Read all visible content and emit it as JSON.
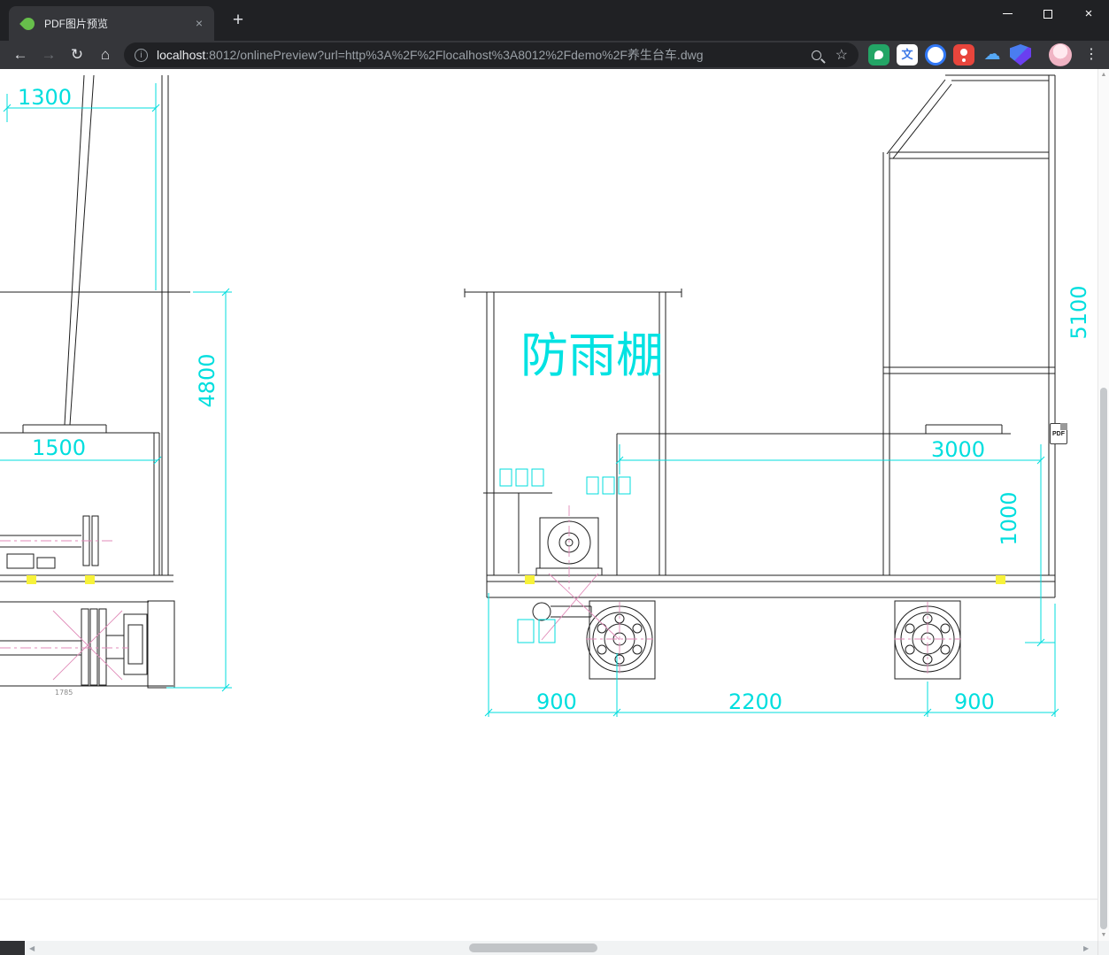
{
  "tab_strip": {
    "active_tab_title": "PDF图片预览"
  },
  "glyphs": {
    "tab_close": "×",
    "new_tab": "+",
    "window_close": "×",
    "back": "←",
    "forward": "→",
    "reload": "↻",
    "home": "⌂",
    "info": "i",
    "star": "☆",
    "menu_dots": "⋮",
    "translate": "文",
    "cloud": "☁",
    "up_arrow": "▲",
    "down_arrow": "▼",
    "left_arrow": "◀",
    "right_arrow": "▶"
  },
  "address_bar": {
    "host": "localhost",
    "rest": ":8012/onlinePreview?url=http%3A%2F%2Flocalhost%3A8012%2Fdemo%2F养生台车.dwg"
  },
  "drawing": {
    "canopy_label": "防雨棚",
    "dims": {
      "d1300": "1300",
      "d4800": "4800",
      "d1500": "1500",
      "d1785": "1785",
      "d5100": "5100",
      "d3000": "3000",
      "d1000": "1000",
      "d900_left": "900",
      "d2200": "2200",
      "d900_right": "900"
    },
    "colors": {
      "dimension_cyan": "#00dede",
      "line_black": "#1f1f1f",
      "centerline_pink": "#e08bb8",
      "highlight_yellow": "#f7f23a",
      "canopy_text": "#00e2e2"
    }
  },
  "pdf_icon": {
    "label": "PDF"
  }
}
